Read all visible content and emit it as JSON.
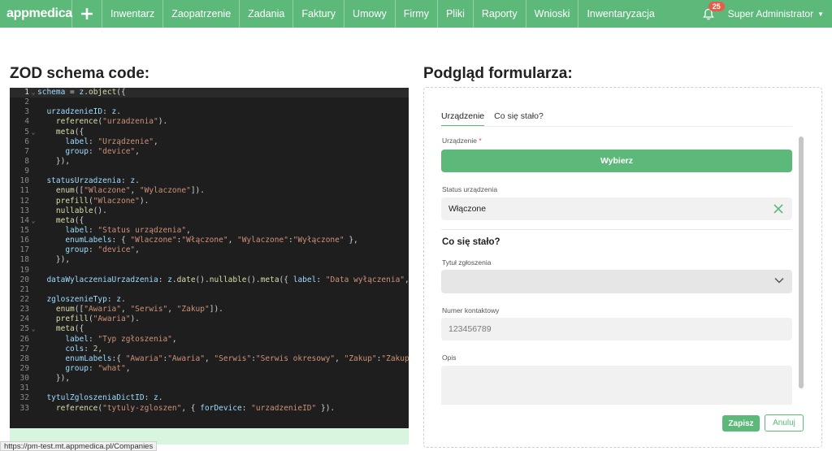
{
  "app": {
    "logo": "appmedica"
  },
  "nav": {
    "items": [
      "Inwentarz",
      "Zaopatrzenie",
      "Zadania",
      "Faktury",
      "Umowy",
      "Firmy",
      "Pliki",
      "Raporty",
      "Wnioski",
      "Inwentaryzacja"
    ],
    "notifications_count": "25",
    "user_name": "Super Administrator"
  },
  "left": {
    "heading": "ZOD schema code:",
    "lines": [
      "schema = z.object({",
      "",
      "  urzadzenieID: z.",
      "    reference(\"urzadzenia\").",
      "    meta({",
      "      label: \"Urządzenie\",",
      "      group: \"device\",",
      "    }),",
      "",
      "  statusUrzadzenia: z.",
      "    enum([\"Wlaczone\", \"Wylaczone\"]).",
      "    prefill(\"Wlaczone\").",
      "    nullable().",
      "    meta({",
      "      label: \"Status urządzenia\",",
      "      enumLabels: { \"Wlaczone\":\"Włączone\", \"Wylaczone\":\"Wyłączone\" },",
      "      group: \"device\",",
      "    }),",
      "",
      "  dataWylaczeniaUrzadzenia: z.date().nullable().meta({ label: \"Data wyłączenia\", gro",
      "",
      "  zgloszenieTyp: z.",
      "    enum([\"Awaria\", \"Serwis\", \"Zakup\"]).",
      "    prefill(\"Awaria\").",
      "    meta({",
      "      label: \"Typ zgłoszenia\",",
      "      cols: 2,",
      "      enumLabels:{ \"Awaria\":\"Awaria\", \"Serwis\":\"Serwis okresowy\", \"Zakup\":\"Zakup\" },",
      "      group: \"what\",",
      "    }),",
      "",
      "  tytulZgloszeniaDictID: z.",
      "    reference(\"tytuly-zgloszen\", { forDevice: \"urzadzenieID\" })."
    ],
    "folds": [
      1,
      5,
      14,
      25
    ],
    "status_url": "https://pm-test.mt.appmedica.pl/Companies"
  },
  "right": {
    "heading": "Podgląd formularza:",
    "tabs": [
      "Urządzenie",
      "Co się stało?"
    ],
    "device_label": "Urządzenie",
    "required_mark": "*",
    "choose_button": "Wybierz",
    "status_label": "Status urządzenia",
    "status_value": "Włączone",
    "section_title": "Co się stało?",
    "title_label": "Tytuł zgłoszenia",
    "title_value": "",
    "phone_label": "Numer kontaktowy",
    "phone_placeholder": "123456789",
    "desc_label": "Opis",
    "save_button": "Zapisz",
    "cancel_button": "Anuluj"
  },
  "colors": {
    "accent": "#5cb97a",
    "badge": "#e85c4a",
    "editor_bg": "#1e1e1e"
  }
}
